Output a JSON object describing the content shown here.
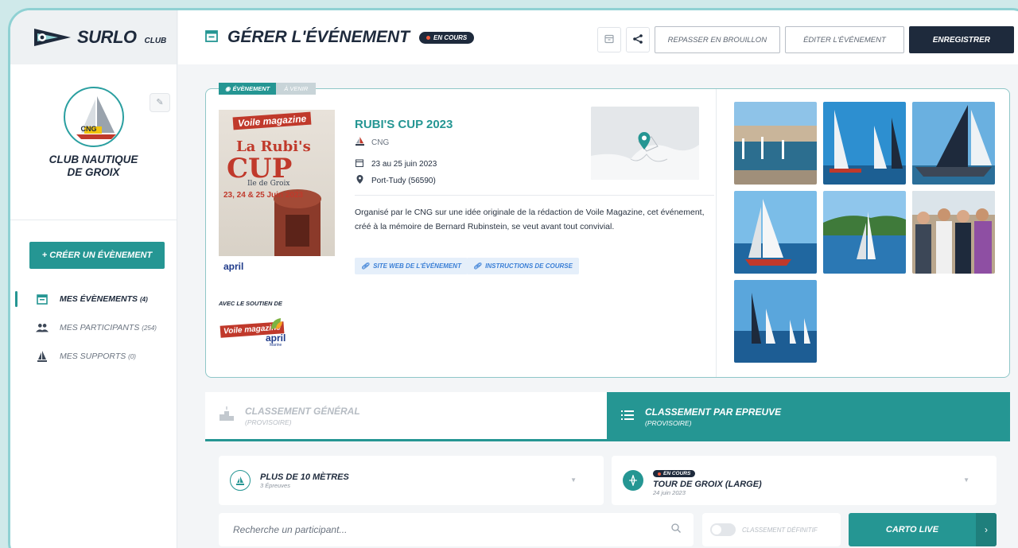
{
  "brand": {
    "name": "SURLO",
    "suffix": "CLUB"
  },
  "club": {
    "name_line1": "CLUB NAUTIQUE",
    "name_line2": "DE GROIX",
    "logo_text": "CNG"
  },
  "sidebar": {
    "create_label": "+ CRÉER UN ÉVÈNEMENT",
    "items": [
      {
        "label": "MES ÉVÈNEMENTS",
        "count": "(4)",
        "icon": "calendar-icon",
        "active": true
      },
      {
        "label": "MES PARTICIPANTS",
        "count": "(254)",
        "icon": "people-icon",
        "active": false
      },
      {
        "label": "MES SUPPORTS",
        "count": "(0)",
        "icon": "sailboat-icon",
        "active": false
      }
    ]
  },
  "header": {
    "title": "GÉRER L'ÉVÉNEMENT",
    "status": "EN COURS",
    "btn_draft": "REPASSER EN BROUILLON",
    "btn_edit": "ÉDITER L'ÉVÉNEMENT",
    "btn_save": "ENREGISTRER"
  },
  "event": {
    "tag": "ÉVÈNEMENT",
    "tag_state": "À VENIR",
    "title": "RUBI'S CUP 2023",
    "organizer": "CNG",
    "dates": "23 au 25 juin 2023",
    "location": "Port-Tudy (56590)",
    "description": "Organisé par le CNG sur une idée originale de la rédaction de Voile Magazine, cet événement, créé à la mémoire de Bernard Rubinstein, se veut avant tout convivial.",
    "link_website": "SITE WEB DE L'ÉVÉNEMENT",
    "link_instructions": "INSTRUCTIONS DE COURSE",
    "supports_label": "AVEC LE SOUTIEN DE",
    "poster": {
      "brand": "Voile magazine",
      "title1": "La Rubi's",
      "title2": "CUP",
      "place": "Ile de Groix",
      "dates": "23, 24 & 25 Juin 2023",
      "sponsor": "april"
    },
    "sponsors": [
      {
        "name": "Voile magazine"
      },
      {
        "name": "april",
        "sub": "Marine"
      }
    ]
  },
  "tabs": [
    {
      "label": "CLASSEMENT GÉNÉRAL",
      "sub": "(PROVISOIRE)",
      "active": false
    },
    {
      "label": "CLASSEMENT PAR EPREUVE",
      "sub": "(PROVISOIRE)",
      "active": true
    }
  ],
  "filters": {
    "category": {
      "title": "PLUS DE 10 MÈTRES",
      "sub": "3 Épreuves"
    },
    "race": {
      "status": "EN COURS",
      "title": "TOUR DE GROIX (LARGE)",
      "date": "24 juin 2023"
    },
    "search_placeholder": "Recherche un participant...",
    "toggle_label": "CLASSEMENT DÉFINITIF",
    "carto_label": "CARTO LIVE"
  },
  "colors": {
    "accent": "#259693",
    "dark": "#1e2a3c",
    "live": "#f25a3c"
  }
}
